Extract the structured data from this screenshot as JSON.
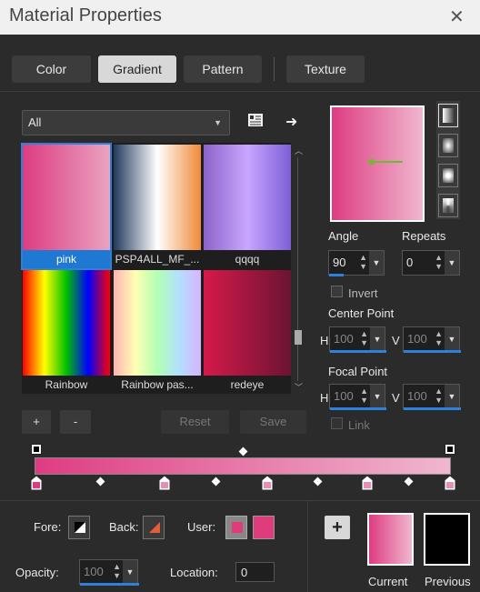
{
  "window": {
    "title": "Material Properties",
    "close": "✕"
  },
  "tabs": [
    {
      "label": "Color"
    },
    {
      "label": "Gradient"
    },
    {
      "label": "Pattern"
    },
    {
      "label": "Texture"
    }
  ],
  "filter": {
    "value": "All"
  },
  "gradients": [
    {
      "name": "pink",
      "colors": [
        "#de3c81",
        "#e9a3c0"
      ]
    },
    {
      "name": "PSP4ALL_MF_...",
      "colors": [
        "#223a5e",
        "#ffffff",
        "#f08a3a"
      ]
    },
    {
      "name": "qqqq",
      "colors": [
        "#8c63c9",
        "#c9a6ff",
        "#7c5fd6"
      ]
    },
    {
      "name": "Rainbow",
      "colors": [
        "#ff0000",
        "#ffff00",
        "#00c000",
        "#0000ff",
        "#ff0000"
      ]
    },
    {
      "name": "Rainbow pas...",
      "colors": [
        "#ffb3b3",
        "#ffffb3",
        "#b3ffb3",
        "#b3e0ff",
        "#d8b3ff"
      ]
    },
    {
      "name": "redeye",
      "colors": [
        "#d6194a",
        "#6b1433"
      ]
    }
  ],
  "buttons": {
    "add": "+",
    "remove": "-",
    "reset": "Reset",
    "save": "Save"
  },
  "angle": {
    "label": "Angle",
    "value": "90"
  },
  "repeats": {
    "label": "Repeats",
    "value": "0"
  },
  "invert": {
    "label": "Invert",
    "checked": false
  },
  "center_point": {
    "label": "Center Point",
    "h_label": "H",
    "h": "100",
    "v_label": "V",
    "v": "100"
  },
  "focal_point": {
    "label": "Focal Point",
    "h_label": "H",
    "h": "100",
    "v_label": "V",
    "v": "100"
  },
  "link": {
    "label": "Link"
  },
  "bottom": {
    "fore_label": "Fore:",
    "back_label": "Back:",
    "user_label": "User:",
    "opacity_label": "Opacity:",
    "opacity_value": "100",
    "location_label": "Location:",
    "location_value": "0",
    "add_swatch": "+",
    "current_label": "Current",
    "previous_label": "Previous",
    "user_color": "#de3c7a",
    "previous_color": "#000000"
  },
  "colors": {
    "accent": "#2f80d8",
    "gradient_start": "#de3c81",
    "gradient_end": "#f0b7cf"
  }
}
